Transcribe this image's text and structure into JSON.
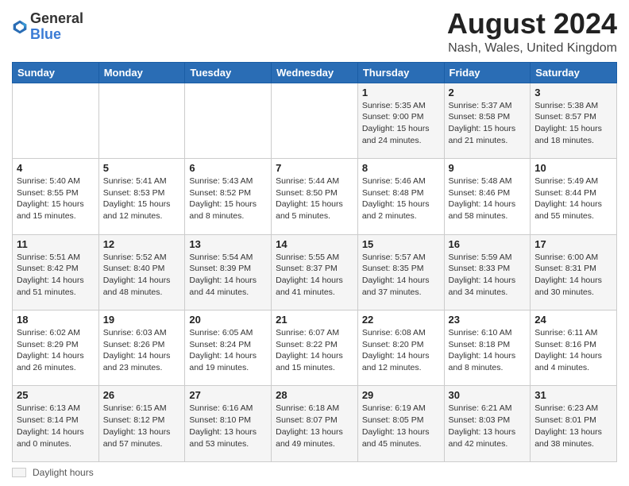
{
  "header": {
    "logo_line1": "General",
    "logo_line2": "Blue",
    "month_title": "August 2024",
    "location": "Nash, Wales, United Kingdom"
  },
  "footer": {
    "legend_label": "Daylight hours"
  },
  "days_of_week": [
    "Sunday",
    "Monday",
    "Tuesday",
    "Wednesday",
    "Thursday",
    "Friday",
    "Saturday"
  ],
  "weeks": [
    [
      {
        "day": "",
        "info": ""
      },
      {
        "day": "",
        "info": ""
      },
      {
        "day": "",
        "info": ""
      },
      {
        "day": "",
        "info": ""
      },
      {
        "day": "1",
        "info": "Sunrise: 5:35 AM\nSunset: 9:00 PM\nDaylight: 15 hours\nand 24 minutes."
      },
      {
        "day": "2",
        "info": "Sunrise: 5:37 AM\nSunset: 8:58 PM\nDaylight: 15 hours\nand 21 minutes."
      },
      {
        "day": "3",
        "info": "Sunrise: 5:38 AM\nSunset: 8:57 PM\nDaylight: 15 hours\nand 18 minutes."
      }
    ],
    [
      {
        "day": "4",
        "info": "Sunrise: 5:40 AM\nSunset: 8:55 PM\nDaylight: 15 hours\nand 15 minutes."
      },
      {
        "day": "5",
        "info": "Sunrise: 5:41 AM\nSunset: 8:53 PM\nDaylight: 15 hours\nand 12 minutes."
      },
      {
        "day": "6",
        "info": "Sunrise: 5:43 AM\nSunset: 8:52 PM\nDaylight: 15 hours\nand 8 minutes."
      },
      {
        "day": "7",
        "info": "Sunrise: 5:44 AM\nSunset: 8:50 PM\nDaylight: 15 hours\nand 5 minutes."
      },
      {
        "day": "8",
        "info": "Sunrise: 5:46 AM\nSunset: 8:48 PM\nDaylight: 15 hours\nand 2 minutes."
      },
      {
        "day": "9",
        "info": "Sunrise: 5:48 AM\nSunset: 8:46 PM\nDaylight: 14 hours\nand 58 minutes."
      },
      {
        "day": "10",
        "info": "Sunrise: 5:49 AM\nSunset: 8:44 PM\nDaylight: 14 hours\nand 55 minutes."
      }
    ],
    [
      {
        "day": "11",
        "info": "Sunrise: 5:51 AM\nSunset: 8:42 PM\nDaylight: 14 hours\nand 51 minutes."
      },
      {
        "day": "12",
        "info": "Sunrise: 5:52 AM\nSunset: 8:40 PM\nDaylight: 14 hours\nand 48 minutes."
      },
      {
        "day": "13",
        "info": "Sunrise: 5:54 AM\nSunset: 8:39 PM\nDaylight: 14 hours\nand 44 minutes."
      },
      {
        "day": "14",
        "info": "Sunrise: 5:55 AM\nSunset: 8:37 PM\nDaylight: 14 hours\nand 41 minutes."
      },
      {
        "day": "15",
        "info": "Sunrise: 5:57 AM\nSunset: 8:35 PM\nDaylight: 14 hours\nand 37 minutes."
      },
      {
        "day": "16",
        "info": "Sunrise: 5:59 AM\nSunset: 8:33 PM\nDaylight: 14 hours\nand 34 minutes."
      },
      {
        "day": "17",
        "info": "Sunrise: 6:00 AM\nSunset: 8:31 PM\nDaylight: 14 hours\nand 30 minutes."
      }
    ],
    [
      {
        "day": "18",
        "info": "Sunrise: 6:02 AM\nSunset: 8:29 PM\nDaylight: 14 hours\nand 26 minutes."
      },
      {
        "day": "19",
        "info": "Sunrise: 6:03 AM\nSunset: 8:26 PM\nDaylight: 14 hours\nand 23 minutes."
      },
      {
        "day": "20",
        "info": "Sunrise: 6:05 AM\nSunset: 8:24 PM\nDaylight: 14 hours\nand 19 minutes."
      },
      {
        "day": "21",
        "info": "Sunrise: 6:07 AM\nSunset: 8:22 PM\nDaylight: 14 hours\nand 15 minutes."
      },
      {
        "day": "22",
        "info": "Sunrise: 6:08 AM\nSunset: 8:20 PM\nDaylight: 14 hours\nand 12 minutes."
      },
      {
        "day": "23",
        "info": "Sunrise: 6:10 AM\nSunset: 8:18 PM\nDaylight: 14 hours\nand 8 minutes."
      },
      {
        "day": "24",
        "info": "Sunrise: 6:11 AM\nSunset: 8:16 PM\nDaylight: 14 hours\nand 4 minutes."
      }
    ],
    [
      {
        "day": "25",
        "info": "Sunrise: 6:13 AM\nSunset: 8:14 PM\nDaylight: 14 hours\nand 0 minutes."
      },
      {
        "day": "26",
        "info": "Sunrise: 6:15 AM\nSunset: 8:12 PM\nDaylight: 13 hours\nand 57 minutes."
      },
      {
        "day": "27",
        "info": "Sunrise: 6:16 AM\nSunset: 8:10 PM\nDaylight: 13 hours\nand 53 minutes."
      },
      {
        "day": "28",
        "info": "Sunrise: 6:18 AM\nSunset: 8:07 PM\nDaylight: 13 hours\nand 49 minutes."
      },
      {
        "day": "29",
        "info": "Sunrise: 6:19 AM\nSunset: 8:05 PM\nDaylight: 13 hours\nand 45 minutes."
      },
      {
        "day": "30",
        "info": "Sunrise: 6:21 AM\nSunset: 8:03 PM\nDaylight: 13 hours\nand 42 minutes."
      },
      {
        "day": "31",
        "info": "Sunrise: 6:23 AM\nSunset: 8:01 PM\nDaylight: 13 hours\nand 38 minutes."
      }
    ]
  ]
}
